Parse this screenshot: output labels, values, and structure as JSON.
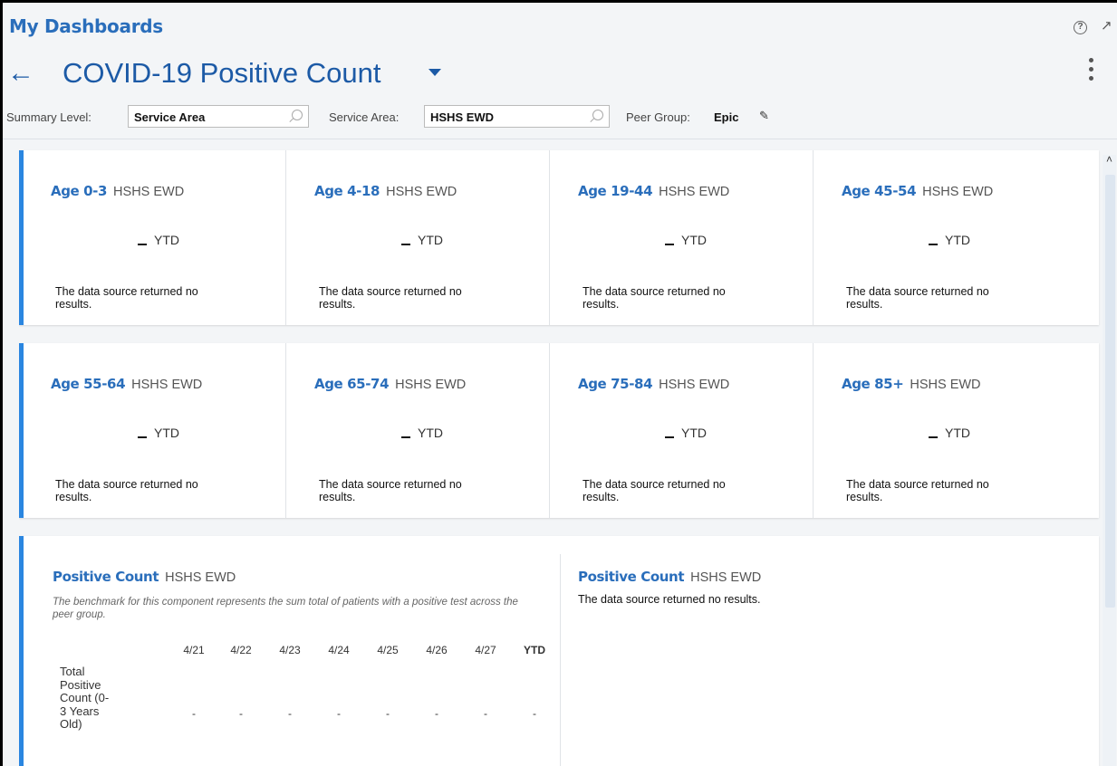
{
  "app": {
    "title": "My Dashboards",
    "help_icon": "?",
    "pin_icon": "pin"
  },
  "dashboard": {
    "back_icon": "←",
    "title": "COVID-19 Positive Count"
  },
  "filters": {
    "summary_label": "Summary Level:",
    "summary_value": "Service Area",
    "service_label": "Service Area:",
    "service_value": "HSHS EWD",
    "peer_label": "Peer Group:",
    "peer_value": "Epic"
  },
  "tiles_row1": [
    {
      "name": "Age 0-3",
      "area": "HSHS EWD",
      "metric": "YTD",
      "message": "The data source returned no results."
    },
    {
      "name": "Age 4-18",
      "area": "HSHS EWD",
      "metric": "YTD",
      "message": "The data source returned no results."
    },
    {
      "name": "Age 19-44",
      "area": "HSHS EWD",
      "metric": "YTD",
      "message": "The data source returned no results."
    },
    {
      "name": "Age 45-54",
      "area": "HSHS EWD",
      "metric": "YTD",
      "message": "The data source returned no results."
    }
  ],
  "tiles_row2": [
    {
      "name": "Age 55-64",
      "area": "HSHS EWD",
      "metric": "YTD",
      "message": "The data source returned no results."
    },
    {
      "name": "Age 65-74",
      "area": "HSHS EWD",
      "metric": "YTD",
      "message": "The data source returned no results."
    },
    {
      "name": "Age 75-84",
      "area": "HSHS EWD",
      "metric": "YTD",
      "message": "The data source returned no results."
    },
    {
      "name": "Age 85+",
      "area": "HSHS EWD",
      "metric": "YTD",
      "message": "The data source returned no results."
    }
  ],
  "positive_count": {
    "left": {
      "title": "Positive Count",
      "area": "HSHS EWD",
      "note": "The benchmark for this component represents the sum total of patients with a positive test across the peer group.",
      "columns": [
        "4/21",
        "4/22",
        "4/23",
        "4/24",
        "4/25",
        "4/26",
        "4/27",
        "YTD"
      ],
      "row_label": "Total Positive Count (0-3 Years Old)",
      "row_values": [
        "-",
        "-",
        "-",
        "-",
        "-",
        "-",
        "-",
        "-"
      ]
    },
    "right": {
      "title": "Positive Count",
      "area": "HSHS EWD",
      "message": "The data source returned no results."
    }
  }
}
